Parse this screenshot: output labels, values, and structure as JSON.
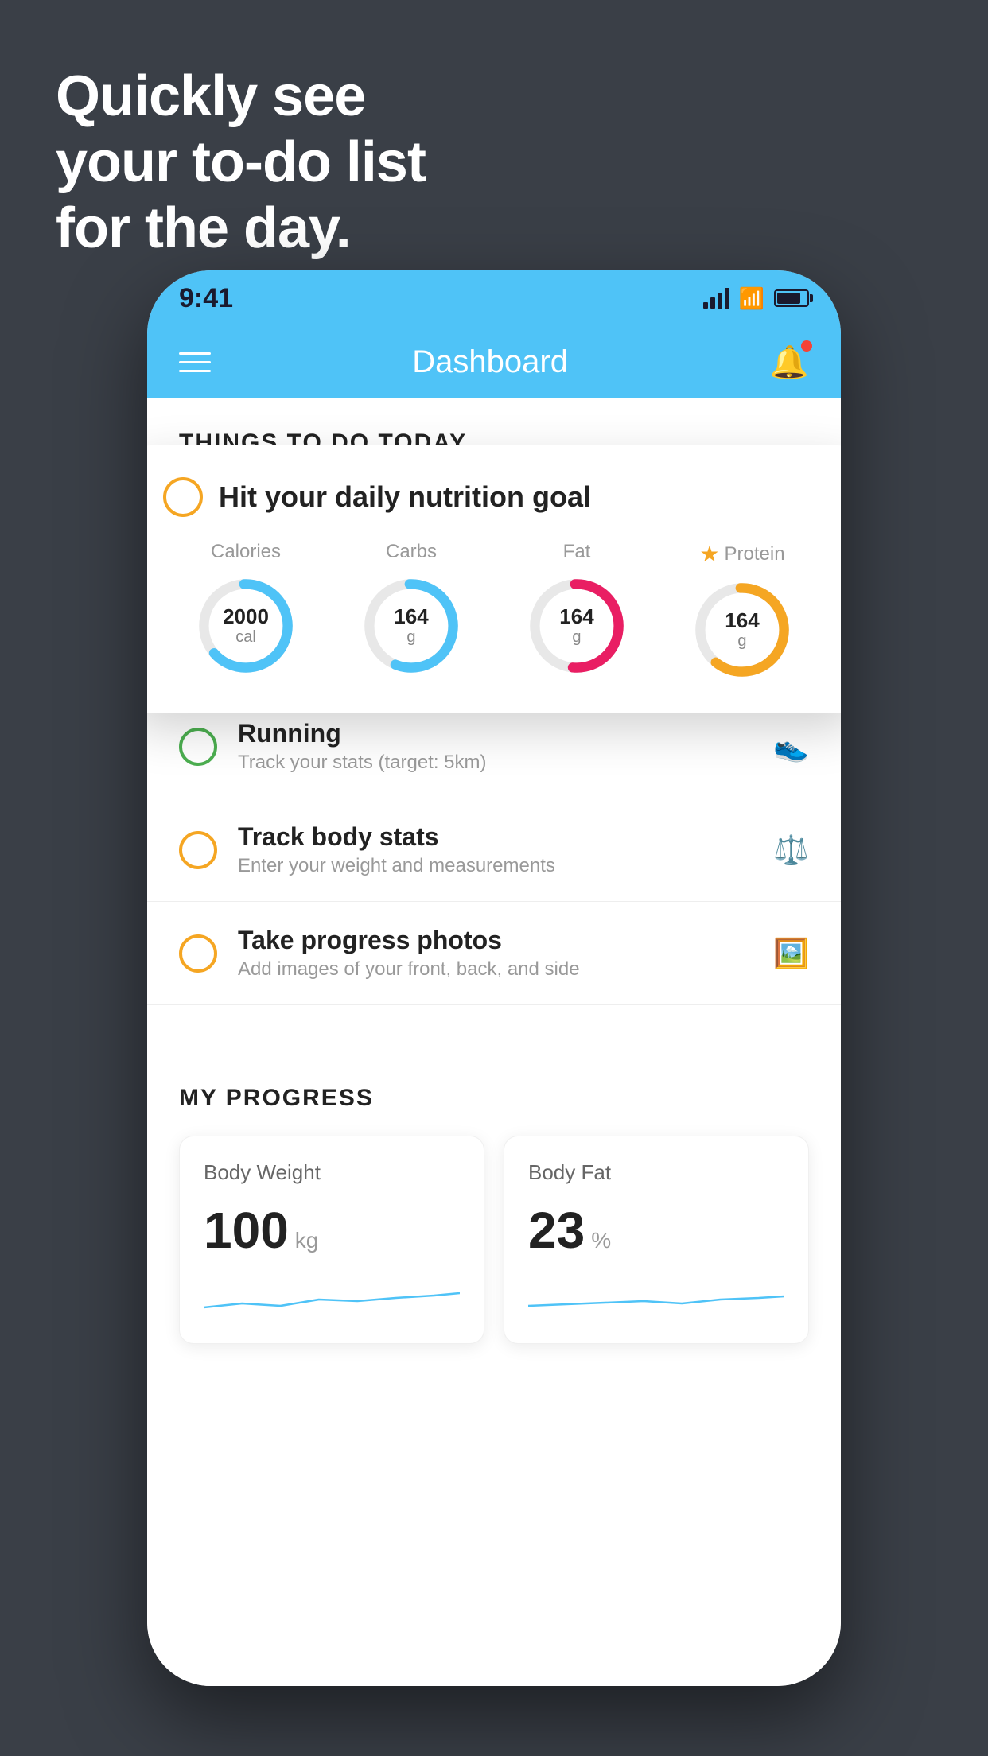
{
  "hero": {
    "line1": "Quickly see",
    "line2": "your to-do list",
    "line3": "for the day."
  },
  "statusBar": {
    "time": "9:41"
  },
  "navBar": {
    "title": "Dashboard"
  },
  "thingsToDoSection": {
    "heading": "THINGS TO DO TODAY"
  },
  "nutritionCard": {
    "title": "Hit your daily nutrition goal",
    "items": [
      {
        "label": "Calories",
        "value": "2000",
        "unit": "cal",
        "color": "#4fc3f7",
        "hasStar": false
      },
      {
        "label": "Carbs",
        "value": "164",
        "unit": "g",
        "color": "#4fc3f7",
        "hasStar": false
      },
      {
        "label": "Fat",
        "value": "164",
        "unit": "g",
        "color": "#e91e63",
        "hasStar": false
      },
      {
        "label": "Protein",
        "value": "164",
        "unit": "g",
        "color": "#f5a623",
        "hasStar": true
      }
    ]
  },
  "todoItems": [
    {
      "name": "Running",
      "desc": "Track your stats (target: 5km)",
      "circleColor": "green",
      "icon": "👟"
    },
    {
      "name": "Track body stats",
      "desc": "Enter your weight and measurements",
      "circleColor": "yellow",
      "icon": "⚖️"
    },
    {
      "name": "Take progress photos",
      "desc": "Add images of your front, back, and side",
      "circleColor": "yellow",
      "icon": "🖼️"
    }
  ],
  "progressSection": {
    "heading": "MY PROGRESS",
    "cards": [
      {
        "title": "Body Weight",
        "value": "100",
        "unit": "kg"
      },
      {
        "title": "Body Fat",
        "value": "23",
        "unit": "%"
      }
    ]
  }
}
